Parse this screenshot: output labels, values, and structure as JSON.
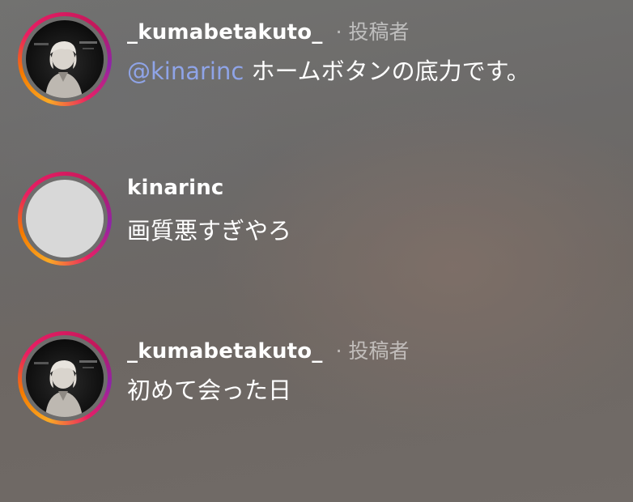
{
  "comments": [
    {
      "username": "_kumabetakuto_",
      "author_tag": "· 投稿者",
      "mention": "@kinarinc",
      "text": " ホームボタンの底力です。"
    },
    {
      "username": "kinarinc",
      "text": "画質悪すぎやろ"
    },
    {
      "username": "_kumabetakuto_",
      "author_tag": "· 投稿者",
      "text": "初めて会った日"
    }
  ],
  "colors": {
    "mention": "#8fa4e8",
    "username": "#ffffff",
    "author_tag": "rgba(255,255,255,0.55)",
    "story_ring": [
      "#f9a825",
      "#e91e63",
      "#8e24aa"
    ]
  }
}
